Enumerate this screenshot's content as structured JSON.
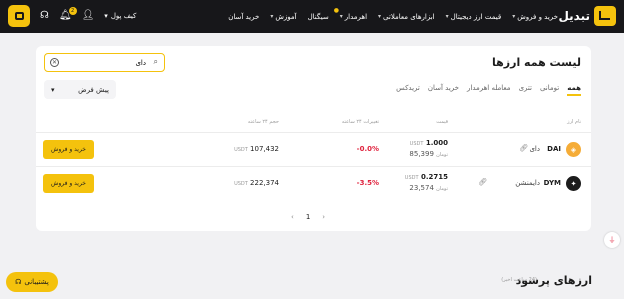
{
  "header": {
    "logo_text": "تبدیل",
    "nav": [
      "خرید و فروش",
      "قیمت ارز دیجیتال",
      "ابزارهای معاملاتی",
      "اهرمدار",
      "سیگنال",
      "آموزش",
      "خرید آسان"
    ],
    "wallet_label": "کیف پول",
    "notification_count": "2"
  },
  "card": {
    "title": "لیست همه ارزها",
    "search_value": "دای",
    "sort_label": "پیش فرض",
    "tabs": [
      "همه",
      "تومانی",
      "تتری",
      "معامله اهرمدار",
      "خرید آسان",
      "تریدکس"
    ],
    "columns": {
      "name": "نام ارز",
      "price": "قیمت",
      "change": "تغییرات ۲۴ ساعته",
      "volume": "حجم ۲۴ ساعته"
    },
    "rows": [
      {
        "symbol": "DAI",
        "name": "دای",
        "price_usdt": "1.000",
        "usdt_unit": "USDT",
        "price_toman": "85,399",
        "toman_unit": "تومان",
        "change": "-0.0%",
        "volume": "107,432",
        "volume_unit": "USDT",
        "trade_label": "خرید و فروش",
        "logo_color": "#f5ac37"
      },
      {
        "symbol": "DYM",
        "name": "دایمنشن",
        "price_usdt": "0.2715",
        "usdt_unit": "USDT",
        "price_toman": "23,574",
        "toman_unit": "تومان",
        "change": "-3.5%",
        "volume": "222,374",
        "volume_unit": "USDT",
        "trade_label": "خرید و فروش",
        "logo_color": "#1c1c1c"
      }
    ],
    "pagination": {
      "current": "1"
    }
  },
  "support_label": "پشتیبانی",
  "section": {
    "title": "ارزهای پرسود",
    "subtitle": "(24 ساعت اخیر)"
  },
  "colors": {
    "accent": "#f4c20d",
    "topbar": "#17171a",
    "negative": "#e0243f"
  },
  "icons": [
    "logo-icon",
    "wallet-icon",
    "bell-icon",
    "user-icon",
    "headset-icon",
    "search-icon",
    "clear-icon",
    "chevron-down-icon",
    "link-icon",
    "chevron-left-icon",
    "chevron-right-icon",
    "pdf-icon"
  ]
}
